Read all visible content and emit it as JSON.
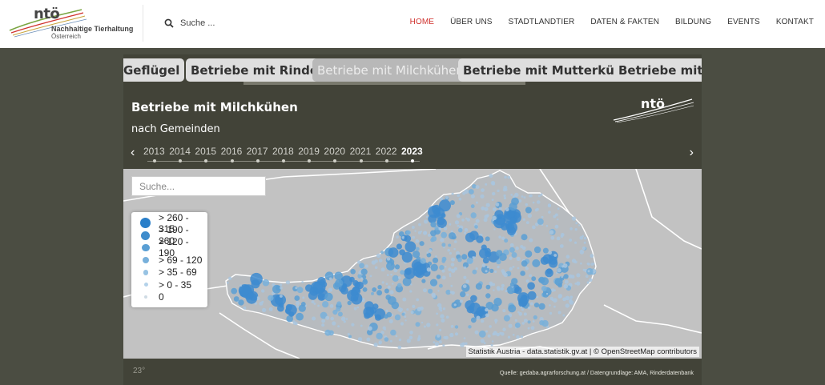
{
  "header": {
    "logo": {
      "brand": "ntö",
      "line1": "Nachhaltige Tierhaltung",
      "line2": "Österreich"
    },
    "search": {
      "placeholder": "Suche ..."
    },
    "nav": [
      {
        "label": "HOME",
        "active": true
      },
      {
        "label": "ÜBER UNS",
        "active": false
      },
      {
        "label": "STADTLANDTIER",
        "active": false
      },
      {
        "label": "DATEN & FAKTEN",
        "active": false
      },
      {
        "label": "BILDUNG",
        "active": false
      },
      {
        "label": "EVENTS",
        "active": false
      },
      {
        "label": "KONTAKT",
        "active": false
      }
    ]
  },
  "tabs": [
    {
      "label": "Geflügel",
      "active": false
    },
    {
      "label": "Betriebe mit Rindern",
      "active": false
    },
    {
      "label": "Betriebe mit Milchkühen",
      "active": true
    },
    {
      "label": "Betriebe mit Mutterkühen",
      "active": false
    },
    {
      "label": "Betriebe mit Schafen",
      "active": false
    }
  ],
  "panel": {
    "title": "Betriebe mit Milchkühen",
    "subtitle": "nach Gemeinden",
    "logo": "ntö",
    "years": [
      "2013",
      "2014",
      "2015",
      "2016",
      "2017",
      "2018",
      "2019",
      "2020",
      "2021",
      "2022",
      "2023"
    ],
    "selected_year": "2023",
    "prev_icon": "‹",
    "next_icon": "›",
    "map_search_placeholder": "Suche...",
    "legend": [
      {
        "label": "> 260 - 315",
        "color": "#2a7fc9"
      },
      {
        "label": "> 190 - 260",
        "color": "#3f8ccc"
      },
      {
        "label": "> 120 - 190",
        "color": "#5a9fd4"
      },
      {
        "label": "> 69 - 120",
        "color": "#78b0db"
      },
      {
        "label": "> 35 - 69",
        "color": "#98c3e3"
      },
      {
        "label": "> 0 - 35",
        "color": "#b4d2ea"
      },
      {
        "label": "0",
        "color": "#cfdbe4"
      }
    ],
    "attribution": "Statistik Austria - data.statistik.gv.at | © OpenStreetMap contributors",
    "footer_left": "23°",
    "footer_source": "Quelle: gedaba.agrarforschung.at / Datengrundlage: AMA, Rinderdatenbank"
  },
  "colors": {
    "accent_nav": "#d0312d",
    "panel_bg": "#424338",
    "map_bg": "#c2c2c2",
    "dot_blue": "#3d8bd0"
  }
}
